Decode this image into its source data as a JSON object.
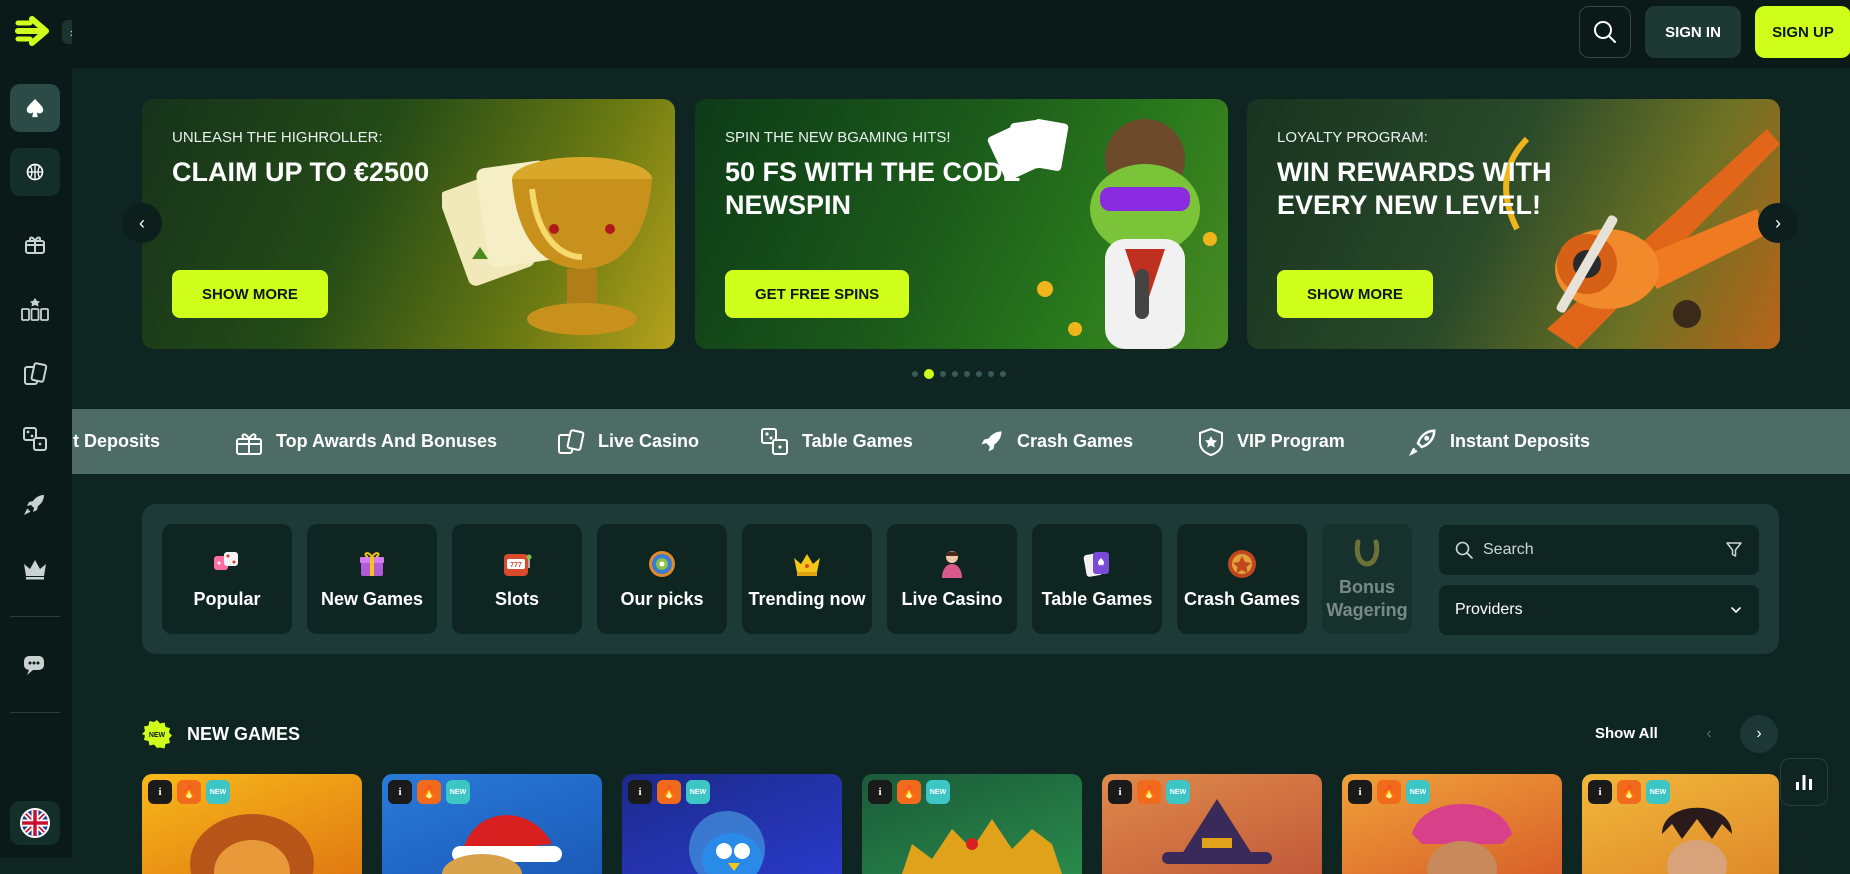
{
  "header": {
    "signin_label": "SIGN IN",
    "signup_label": "SIGN UP"
  },
  "sidebar": {
    "items": [
      "poker-chip",
      "basketball",
      "gift-box",
      "slots",
      "cards",
      "dice-table",
      "rocket",
      "crown",
      "chat"
    ],
    "language": "English (UK)"
  },
  "banners": [
    {
      "subtitle": "UNLEASH THE HIGHROLLER:",
      "title": "CLAIM UP TO €2500",
      "button": "SHOW MORE"
    },
    {
      "subtitle": "SPIN THE NEW BGAMING HITS!",
      "title": "50 FS WITH THE CODE NEWSPIN",
      "button": "GET FREE SPINS"
    },
    {
      "subtitle": "LOYALTY PROGRAM:",
      "title": "WIN REWARDS WITH EVERY NEW LEVEL!",
      "button": "SHOW MORE"
    }
  ],
  "carousel": {
    "total_dots": 8,
    "active_index": 1
  },
  "marquee": [
    "Instant Deposits",
    "Top Awards And Bonuses",
    "Live Casino",
    "Table Games",
    "Crash Games",
    "VIP Program",
    "Instant Deposits"
  ],
  "categories": [
    "Popular",
    "New Games",
    "Slots",
    "Our picks",
    "Trending now",
    "Live Casino",
    "Table Games",
    "Crash Games",
    "Bonus Wagering"
  ],
  "filters": {
    "search_placeholder": "Search",
    "providers_label": "Providers"
  },
  "new_games": {
    "title": "NEW GAMES",
    "badge": "NEW",
    "show_all": "Show All",
    "tag_info": "i",
    "tag_new": "NEW",
    "tiles": 7
  },
  "colors": {
    "accent": "#cfff1a",
    "background": "#0f2521",
    "sidebar": "#0a1a18",
    "marquee": "#4e6c66"
  }
}
